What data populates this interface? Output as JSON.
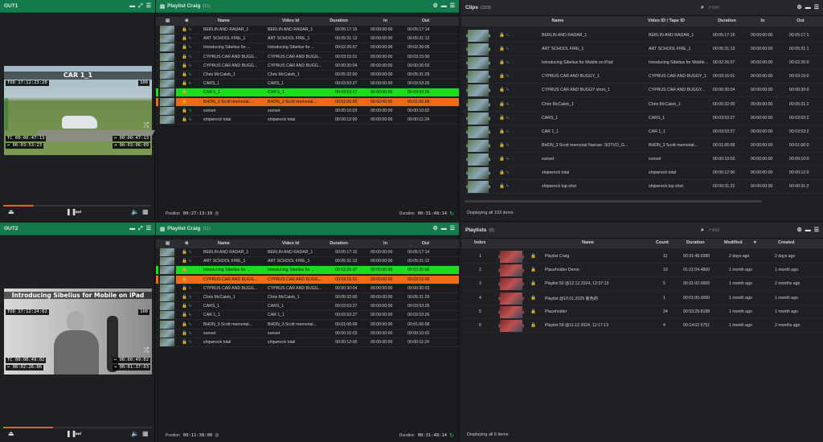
{
  "out1": {
    "title": "OUT1",
    "clip_title": "CAR 1_1",
    "tod": "TOD 17:12:23:20",
    "hundred": "100",
    "tc": "TC 00:00:47:13",
    "remain": "↩ 00:03:53:23",
    "end1": "↦ 00:00:47:13",
    "end2": "⇥ 00:03:06:09"
  },
  "out2": {
    "title": "OUT2",
    "clip_title": "Introducing Sibelius for Mobile on iPad",
    "tod": "TOD 17:12:24:02",
    "hundred": "100",
    "tc": "TC 00:00:49:02",
    "remain": "↩ 00:02:26:06",
    "end1": "↦ 00:00:49:02",
    "end2": "⇥ 00:01:37:03"
  },
  "pl1": {
    "title": "Playlist Craig",
    "count": "(11)",
    "position_label": "Position",
    "position": "00:27:13:19",
    "duration_label": "Duration",
    "duration": "00:31:48:14"
  },
  "pl2": {
    "title": "Playlist Craig",
    "count": "(11)",
    "position_label": "Position",
    "position": "00:11:38:00",
    "duration_label": "Duration",
    "duration": "00:31:48:14"
  },
  "pl_headers": {
    "name": "Name",
    "vid": "Video Id",
    "dur": "Duration",
    "in": "In",
    "out": "Out"
  },
  "pl1_rows": [
    {
      "name": "BERLIN AND RADAR_1",
      "vid": "BERLIN AND RADAR_1",
      "dur": "00:05:17:15",
      "in": "00:00:00:00",
      "out": "00:05:17:14",
      "state": "",
      "lock": ""
    },
    {
      "name": "ART SCHOOL FIRE_1",
      "vid": "ART SCHOOL FIRE_1",
      "dur": "00:05:31:13",
      "in": "00:00:00:00",
      "out": "00:05:31:12",
      "state": "",
      "lock": ""
    },
    {
      "name": "Introducing Sibelius for ...",
      "vid": "Introducing Sibelius for ...",
      "dur": "00:02:26:07",
      "in": "00:00:00:00",
      "out": "00:02:26:06",
      "state": "",
      "lock": "y"
    },
    {
      "name": "CYPRUS CAR AND BUGG...",
      "vid": "CYPRUS CAR AND BUGG...",
      "dur": "00:03:15:01",
      "in": "00:00:00:00",
      "out": "00:03:15:00",
      "state": "",
      "lock": ""
    },
    {
      "name": "CYPRUS CAR AND BUGG...",
      "vid": "CYPRUS CAR AND BUGG...",
      "dur": "00:00:30:04",
      "in": "00:00:00:00",
      "out": "00:00:30:03",
      "state": "",
      "lock": ""
    },
    {
      "name": "Chris McCaleb_1",
      "vid": "Chris McCaleb_1",
      "dur": "00:05:32:00",
      "in": "00:00:00:00",
      "out": "00:05:31:29",
      "state": "",
      "lock": ""
    },
    {
      "name": "CARS_1",
      "vid": "CARS_1",
      "dur": "00:03:53:27",
      "in": "00:00:00:00",
      "out": "00:03:53:26",
      "state": "",
      "lock": ""
    },
    {
      "name": "CAR 1_1",
      "vid": "CAR 1_1",
      "dur": "00:03:53:27",
      "in": "00:00:00:00",
      "out": "00:03:53:26",
      "state": "green",
      "lock": ""
    },
    {
      "name": "BHDN_3 Scott memorial...",
      "vid": "BHDN_3 Scott memorial...",
      "dur": "00:01:06:09",
      "in": "00:00:00:00",
      "out": "00:01:06:08",
      "state": "orange",
      "lock": ""
    },
    {
      "name": "sunset",
      "vid": "sunset",
      "dur": "00:00:10:03",
      "in": "00:00:00:00",
      "out": "00:00:10:02",
      "state": "",
      "lock": ""
    },
    {
      "name": "shipwreck total",
      "vid": "shipwreck total",
      "dur": "00:00:12:00",
      "in": "00:00:00:00",
      "out": "00:00:11:24",
      "state": "",
      "lock": ""
    }
  ],
  "pl2_rows": [
    {
      "name": "BERLIN AND RADAR_1",
      "vid": "BERLIN AND RADAR_1",
      "dur": "00:05:17:15",
      "in": "00:00:00:00",
      "out": "00:05:17:14",
      "state": "",
      "lock": ""
    },
    {
      "name": "ART SCHOOL FIRE_1",
      "vid": "ART SCHOOL FIRE_1",
      "dur": "00:05:31:13",
      "in": "00:00:00:00",
      "out": "00:05:31:12",
      "state": "",
      "lock": ""
    },
    {
      "name": "Introducing Sibelius for ...",
      "vid": "Introducing Sibelius for ...",
      "dur": "00:02:26:07",
      "in": "00:00:00:00",
      "out": "00:02:26:06",
      "state": "green",
      "lock": "y"
    },
    {
      "name": "CYPRUS CAR AND BUGG...",
      "vid": "CYPRUS CAR AND BUGG...",
      "dur": "00:03:15:01",
      "in": "00:00:00:00",
      "out": "00:03:15:00",
      "state": "orange",
      "lock": ""
    },
    {
      "name": "CYPRUS CAR AND BUGG...",
      "vid": "CYPRUS CAR AND BUGG...",
      "dur": "00:00:30:04",
      "in": "00:00:00:00",
      "out": "00:00:30:03",
      "state": "",
      "lock": ""
    },
    {
      "name": "Chris McCaleb_1",
      "vid": "Chris McCaleb_1",
      "dur": "00:05:32:00",
      "in": "00:00:00:00",
      "out": "00:05:31:29",
      "state": "",
      "lock": ""
    },
    {
      "name": "CARS_1",
      "vid": "CARS_1",
      "dur": "00:03:53:27",
      "in": "00:00:00:00",
      "out": "00:03:53:26",
      "state": "",
      "lock": ""
    },
    {
      "name": "CAR 1_1",
      "vid": "CAR 1_1",
      "dur": "00:03:53:27",
      "in": "00:00:00:00",
      "out": "00:03:53:26",
      "state": "",
      "lock": "y"
    },
    {
      "name": "BHDN_3 Scott memorial...",
      "vid": "BHDN_3 Scott memorial...",
      "dur": "00:01:06:09",
      "in": "00:00:00:00",
      "out": "00:01:06:08",
      "state": "",
      "lock": ""
    },
    {
      "name": "sunset",
      "vid": "sunset",
      "dur": "00:00:10:03",
      "in": "00:00:00:00",
      "out": "00:00:10:02",
      "state": "",
      "lock": ""
    },
    {
      "name": "shipwreck total",
      "vid": "shipwreck total",
      "dur": "00:00:12:00",
      "in": "00:00:00:00",
      "out": "00:00:11:24",
      "state": "",
      "lock": ""
    }
  ],
  "clips": {
    "title": "Clips",
    "count": "(103)",
    "filter_placeholder": "Filter",
    "footer": "Displaying all 103 items",
    "headers": {
      "name": "Name",
      "vid": "Video ID / Tape ID",
      "dur": "Duration",
      "in": "In",
      "out": "Out"
    },
    "rows": [
      {
        "name": "BERLIN AND RADAR_1",
        "vid": "BERLIN AND RADAR_1",
        "dur": "00:05:17:15",
        "in": "00:00:00:00",
        "out": "00:05:17:1",
        "lock": ""
      },
      {
        "name": "ART SCHOOL FIRE_1",
        "vid": "ART SCHOOL FIRE_1",
        "dur": "00:05:31:13",
        "in": "00:00:00:00",
        "out": "00:05:31:1",
        "lock": ""
      },
      {
        "name": "Introducing Sibelius for Mobile on iPad",
        "vid": "Introducing Sibelius for Mobile on iPad",
        "dur": "00:02:26:07",
        "in": "00:00:00:00",
        "out": "00:02:26:0",
        "lock": "y"
      },
      {
        "name": "CYPRUS CAR AND BUGGY_1",
        "vid": "CYPRUS CAR AND BUGGY_1",
        "dur": "00:03:15:01",
        "in": "00:00:00:00",
        "out": "00:03:15:0",
        "lock": ""
      },
      {
        "name": "CYPRUS CAR AND BUGGY short_1",
        "vid": "CYPRUS CAR AND BUGGY...",
        "dur": "00:00:30:04",
        "in": "00:00:00:00",
        "out": "00:00:30:0",
        "lock": ""
      },
      {
        "name": "Chris McCaleb_1",
        "vid": "Chris McCaleb_1",
        "dur": "00:05:32:00",
        "in": "00:00:00:00",
        "out": "00:05:31:2",
        "lock": ""
      },
      {
        "name": "CARS_1",
        "vid": "CARS_1",
        "dur": "00:03:53:27",
        "in": "00:00:00:00",
        "out": "00:03:53:2",
        "lock": ""
      },
      {
        "name": "CAR 1_1",
        "vid": "CAR 1_1",
        "dur": "00:03:53:27",
        "in": "00:00:00:00",
        "out": "00:03:53:2",
        "lock": "y"
      },
      {
        "name": "BHDN_3 Scott memorial Narcan- SOTVO_G...",
        "vid": "BHDN_3 Scott memorial...",
        "dur": "00:01:06:09",
        "in": "00:00:00:00",
        "out": "00:01:06:0",
        "lock": ""
      },
      {
        "name": "sunset",
        "vid": "sunset",
        "dur": "00:00:10:03",
        "in": "00:00:00:00",
        "out": "00:00:10:0",
        "lock": ""
      },
      {
        "name": "shipwreck total",
        "vid": "shipwreck total",
        "dur": "00:00:12:00",
        "in": "00:00:00:00",
        "out": "00:00:12:0",
        "lock": ""
      },
      {
        "name": "shipwreck top shot",
        "vid": "shipwreck top shot",
        "dur": "00:00:31:22",
        "in": "00:00:00:00",
        "out": "00:00:31:2",
        "lock": ""
      }
    ]
  },
  "playlists": {
    "title": "Playlists",
    "count": "(6)",
    "filter_placeholder": "Filter",
    "footer": "Displaying all 6 items",
    "headers": {
      "index": "Index",
      "name": "Name",
      "count": "Count",
      "dur": "Duration",
      "mod": "Modified",
      "created": "Created"
    },
    "rows": [
      {
        "index": "1",
        "name": "Playlist Craig",
        "count": "11",
        "dur": "00:31:48.6380",
        "mod": "2 days ago",
        "created": "2 days ago",
        "lock": "y"
      },
      {
        "index": "2",
        "name": "Placeholder Demo",
        "count": "10",
        "dur": "01:21:04.4800",
        "mod": "1 month ago",
        "created": "1 month ago",
        "lock": ""
      },
      {
        "index": "3",
        "name": "Playlist 50 @12.12.2024, 12:37:13",
        "count": "5",
        "dur": "00:31:02.0000",
        "mod": "1 month ago",
        "created": "2 months ago",
        "lock": ""
      },
      {
        "index": "4",
        "name": "Playlist @10.01.2025 紫色的",
        "count": "1",
        "dur": "00:01:00.0000",
        "mod": "1 month ago",
        "created": "1 month ago",
        "lock": ""
      },
      {
        "index": "5",
        "name": "Placeholder",
        "count": "34",
        "dur": "00:53:29.8188",
        "mod": "1 month ago",
        "created": "1 month ago",
        "lock": ""
      },
      {
        "index": "6",
        "name": "Playlist 59 @11.12.2024, 12:17:13",
        "count": "4",
        "dur": "00:14:02.5751",
        "mod": "1 month ago",
        "created": "2 months ago",
        "lock": ""
      }
    ]
  }
}
